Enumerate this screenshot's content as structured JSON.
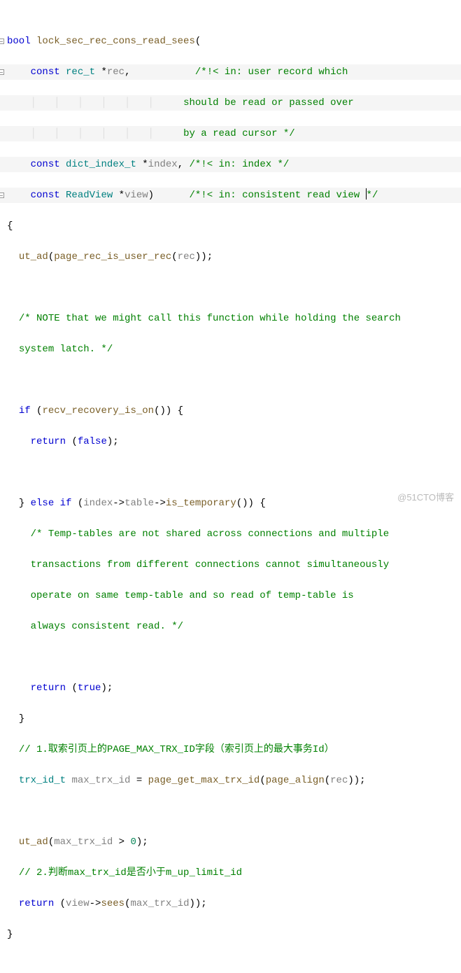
{
  "code": {
    "l1": {
      "kw": "bool",
      "func": "lock_sec_rec_cons_read_sees",
      "open": "("
    },
    "l2": {
      "kw": "const",
      "type": "rec_t",
      "star": "*",
      "ident": "rec",
      "comma": ",",
      "cmt": "/*!< in: user record which"
    },
    "l3": {
      "cmt": "should be read or passed over"
    },
    "l4": {
      "cmt": "by a read cursor */"
    },
    "l5": {
      "kw": "const",
      "type": "dict_index_t",
      "star": "*",
      "ident": "index",
      "comma": ",",
      "cmt": "/*!< in: index */"
    },
    "l6": {
      "kw": "const",
      "type": "ReadView",
      "star": "*",
      "ident": "view",
      "close": ")",
      "cmt_a": "/*!< in: consistent read view ",
      "cmt_b": "*/"
    },
    "l7": {
      "brace": "{"
    },
    "l8": {
      "func": "ut_ad",
      "open": "(",
      "inner": "page_rec_is_user_rec",
      "p2": "(",
      "ident": "rec",
      "p3": "));"
    },
    "l10": {
      "cmt": "/* NOTE that we might call this function while holding the search"
    },
    "l11": {
      "cmt": "system latch. */"
    },
    "l13": {
      "kw": "if",
      "open": "(",
      "func": "recv_recovery_is_on",
      "p": "()) {"
    },
    "l14": {
      "kw": "return",
      "open": "(",
      "val": "false",
      "close": ");"
    },
    "l16": {
      "brace": "}",
      "kw": "else if",
      "open": "(",
      "ident": "index",
      "a1": "->",
      "m1": "table",
      "a2": "->",
      "func": "is_temporary",
      "p": "()) {"
    },
    "l17": {
      "cmt": "/* Temp-tables are not shared across connections and multiple"
    },
    "l18": {
      "cmt": "transactions from different connections cannot simultaneously"
    },
    "l19": {
      "cmt": "operate on same temp-table and so read of temp-table is"
    },
    "l20": {
      "cmt": "always consistent read. */"
    },
    "l22": {
      "kw": "return",
      "open": "(",
      "val": "true",
      "close": ");"
    },
    "l23": {
      "brace": "}"
    },
    "l24": {
      "cmt": "// 1.取索引页上的PAGE_MAX_TRX_ID字段（索引页上的最大事务Id）"
    },
    "l25": {
      "type": "trx_id_t",
      "ident": "max_trx_id",
      "eq": "=",
      "func": "page_get_max_trx_id",
      "open": "(",
      "inner": "page_align",
      "p2": "(",
      "arg": "rec",
      "close": "));"
    },
    "l27": {
      "func": "ut_ad",
      "open": "(",
      "ident": "max_trx_id",
      "op": ">",
      "num": "0",
      "close": ");"
    },
    "l28": {
      "cmt": "// 2.判断max_trx_id是否小于m_up_limit_id"
    },
    "l29": {
      "kw": "return",
      "open": "(",
      "ident": "view",
      "arrow": "->",
      "func": "sees",
      "p2": "(",
      "arg": "max_trx_id",
      "close": "));"
    },
    "l30": {
      "brace": "}"
    }
  },
  "watermark": "@51CTO博客"
}
